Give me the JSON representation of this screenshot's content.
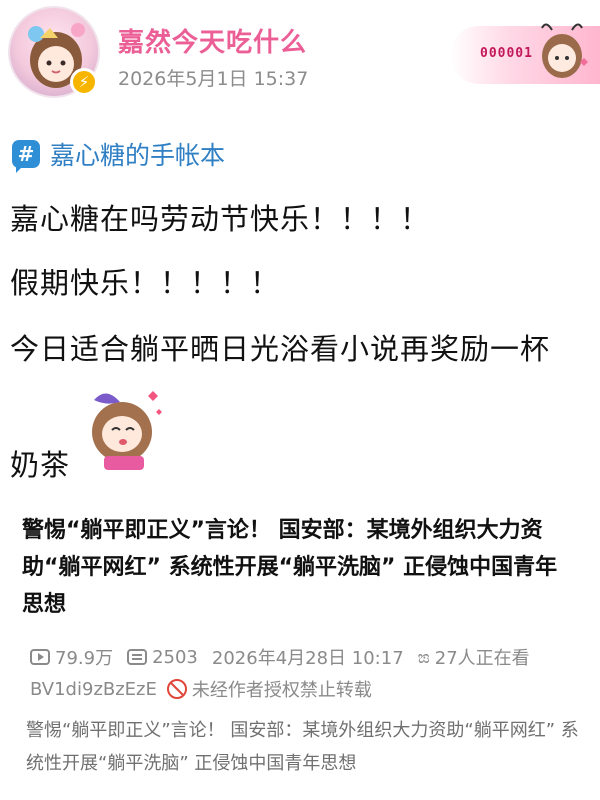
{
  "post": {
    "username": "嘉然今天吃什么",
    "timestamp": "2026年5月1日 15:37",
    "fan_badge": "000001",
    "topic": "嘉心糖的手帐本",
    "lines": [
      "嘉心糖在吗劳动节快乐！！！！",
      "假期快乐！！！！！",
      "今日适合躺平晒日光浴看小说再奖励一杯",
      "奶茶"
    ]
  },
  "shared_video": {
    "title": "警惕“躺平即正义”言论！ 国安部：某境外组织大力资助“躺平网红” 系统性开展“躺平洗脑” 正侵蚀中国青年思想",
    "views": "79.9万",
    "danmaku": "2503",
    "date": "2026年4月28日 10:17",
    "watching": "27人正在看",
    "bvid": "BV1di9zBzEzE",
    "repost_notice": "未经作者授权禁止转载",
    "caption": "警惕“躺平即正义”言论！ 国安部：某境外组织大力资助“躺平网红” 系统性开展“躺平洗脑” 正侵蚀中国青年思想"
  },
  "icons": {
    "verified": "lightning-verified-icon",
    "topic": "hashtag-icon",
    "views": "play-icon",
    "danmaku": "danmaku-icon",
    "watching": "watching-people-icon",
    "no_repost": "prohibited-icon"
  },
  "colors": {
    "username": "#ec5f96",
    "topic": "#2f7fc4",
    "verified": "#f7b500",
    "meta": "#8a8a8a",
    "prohibited": "#e0463a"
  }
}
